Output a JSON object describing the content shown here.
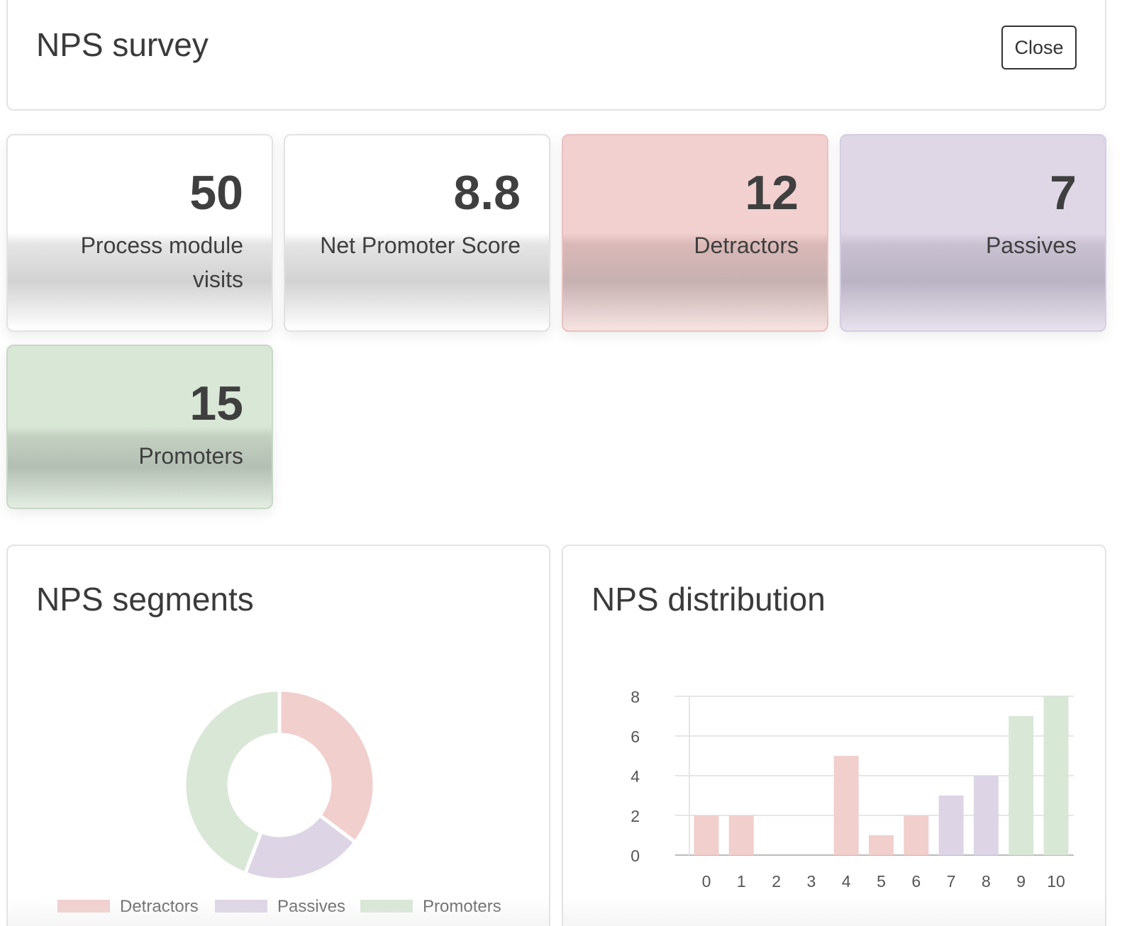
{
  "header": {
    "title": "NPS survey",
    "close_label": "Close"
  },
  "stats": [
    {
      "value": "50",
      "label": "Process module visits"
    },
    {
      "value": "8.8",
      "label": "Net Promoter Score"
    },
    {
      "value": "12",
      "label": "Detractors"
    },
    {
      "value": "7",
      "label": "Passives"
    },
    {
      "value": "15",
      "label": "Promoters"
    }
  ],
  "colors": {
    "detractors": "#f1cfcd",
    "passives": "#ddd5e6",
    "promoters": "#d8e7d6"
  },
  "segments_panel": {
    "title": "NPS segments"
  },
  "distribution_panel": {
    "title": "NPS distribution"
  },
  "chart_data": [
    {
      "type": "pie",
      "title": "NPS segments",
      "categories": [
        "Detractors",
        "Passives",
        "Promoters"
      ],
      "values": [
        12,
        7,
        15
      ],
      "legend": "bottom"
    },
    {
      "type": "bar",
      "title": "NPS distribution",
      "categories": [
        "0",
        "1",
        "2",
        "3",
        "4",
        "5",
        "6",
        "7",
        "8",
        "9",
        "10"
      ],
      "values": [
        2,
        2,
        0,
        0,
        5,
        1,
        2,
        3,
        4,
        7,
        8
      ],
      "segment_of_category": [
        "detractors",
        "detractors",
        "detractors",
        "detractors",
        "detractors",
        "detractors",
        "detractors",
        "passives",
        "passives",
        "promoters",
        "promoters"
      ],
      "yticks": [
        "0",
        "2",
        "4",
        "6",
        "8"
      ],
      "ylim": [
        0,
        8
      ],
      "grid": true
    }
  ]
}
